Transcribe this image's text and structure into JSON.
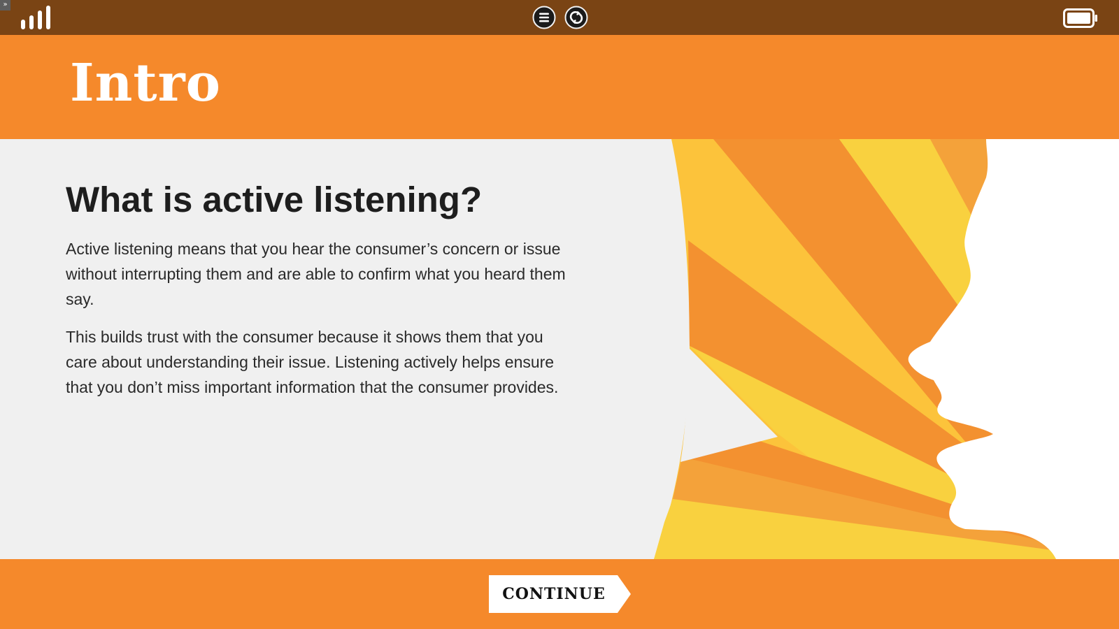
{
  "topbar": {
    "expand_glyph": "»",
    "icons": {
      "signal": "signal-strength-icon",
      "menu": "menu-icon",
      "restart": "restart-icon",
      "battery": "battery-icon"
    }
  },
  "header": {
    "title": "Intro"
  },
  "content": {
    "heading": "What is active listening?",
    "paragraphs": [
      "Active listening means that you hear the consumer’s concern or issue without interrupting them and are able to confirm what you heard them say.",
      "This builds trust with the consumer because it shows them that you care about understanding their issue. Listening actively helps ensure that you don’t miss important information that the consumer provides."
    ]
  },
  "footer": {
    "continue_label": "CONTINUE"
  },
  "colors": {
    "topbar_bg": "#7a4414",
    "accent_orange": "#f5892b",
    "content_bg": "#f0f0f0",
    "ray_yellow": "#fcc33b",
    "ray_light_yellow": "#f9d13f",
    "ray_orange": "#f4a23a",
    "ray_deep_orange": "#f39130",
    "heading_text": "#1e1e1e",
    "body_text": "#2a2a2a",
    "white": "#ffffff"
  }
}
